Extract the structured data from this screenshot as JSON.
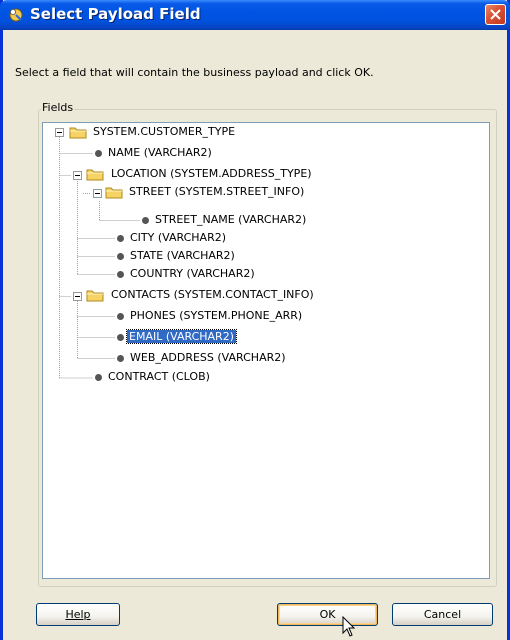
{
  "window": {
    "title": "Select Payload Field",
    "instruction": "Select a field that will contain the business payload and click OK.",
    "fields_legend": "Fields"
  },
  "tree": [
    {
      "label": "SYSTEM.CUSTOMER_TYPE",
      "kind": "folder",
      "expanded": true
    },
    {
      "label": "NAME (VARCHAR2)",
      "kind": "leaf"
    },
    {
      "label": "LOCATION (SYSTEM.ADDRESS_TYPE)",
      "kind": "folder",
      "expanded": true
    },
    {
      "label": "STREET (SYSTEM.STREET_INFO)",
      "kind": "folder",
      "expanded": true
    },
    {
      "label": "STREET_NAME (VARCHAR2)",
      "kind": "leaf"
    },
    {
      "label": "CITY (VARCHAR2)",
      "kind": "leaf"
    },
    {
      "label": "STATE (VARCHAR2)",
      "kind": "leaf"
    },
    {
      "label": "COUNTRY (VARCHAR2)",
      "kind": "leaf"
    },
    {
      "label": "CONTACTS (SYSTEM.CONTACT_INFO)",
      "kind": "folder",
      "expanded": true
    },
    {
      "label": "PHONES (SYSTEM.PHONE_ARR)",
      "kind": "leaf"
    },
    {
      "label": "EMAIL (VARCHAR2)",
      "kind": "leaf",
      "selected": true
    },
    {
      "label": "WEB_ADDRESS (VARCHAR2)",
      "kind": "leaf"
    },
    {
      "label": "CONTRACT (CLOB)",
      "kind": "leaf"
    }
  ],
  "buttons": {
    "help_label": "Help",
    "ok_label": "OK",
    "cancel_label": "Cancel"
  },
  "icons": {
    "title": "payload-wizard-icon",
    "close": "close-icon",
    "folder": "folder-icon",
    "leaf": "field-dot-icon",
    "cursor": "mouse-pointer-icon"
  },
  "colors": {
    "titlebar": "#0054E3",
    "selection": "#316AC5",
    "dialog_bg": "#ECE9D8",
    "close": "#D95032",
    "folder": "#F6D365"
  }
}
